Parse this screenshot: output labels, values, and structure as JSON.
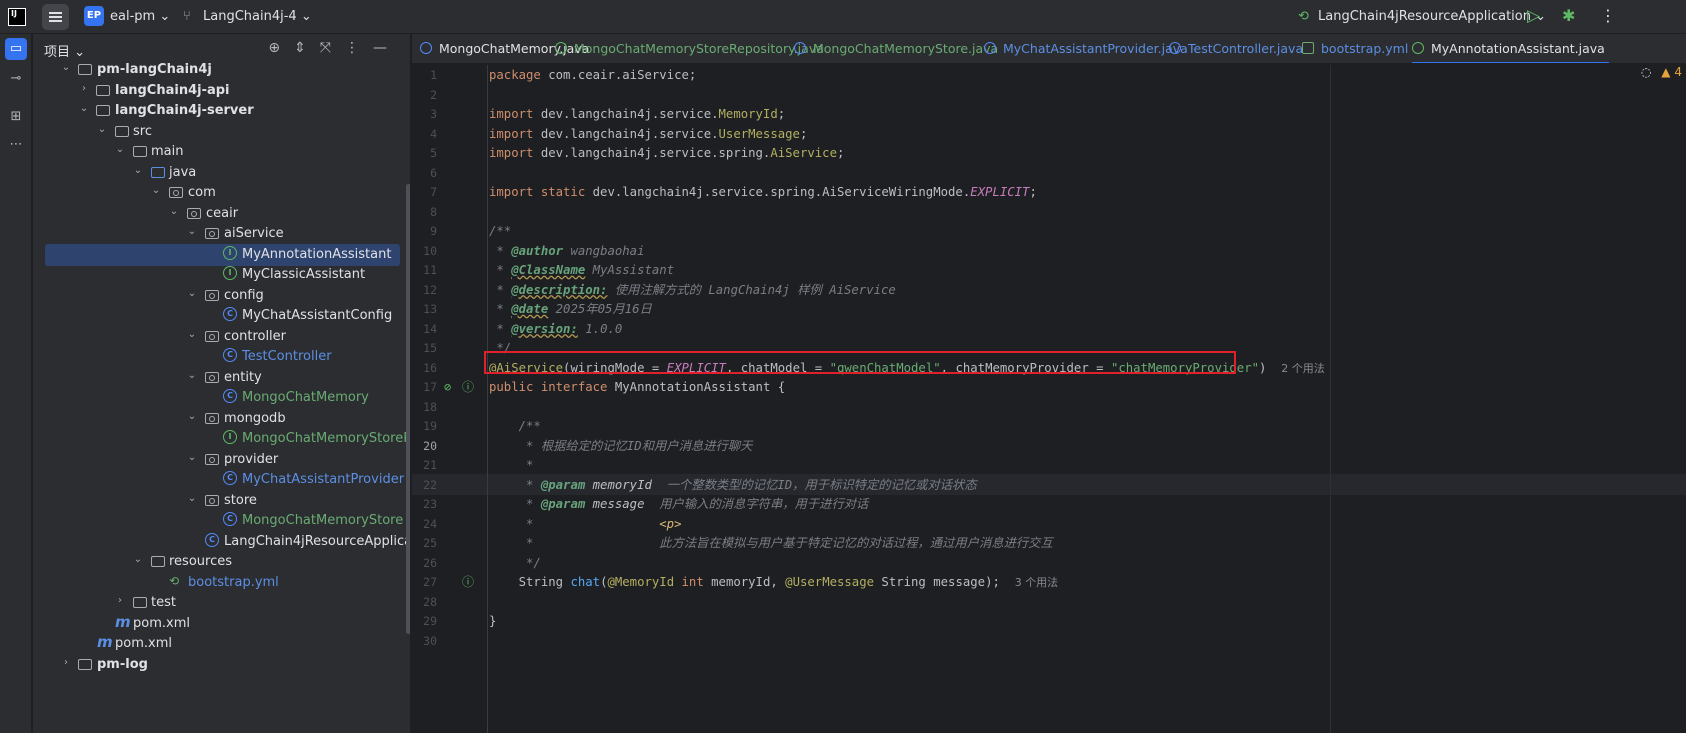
{
  "titlebar": {
    "app_logo": "IJ",
    "project_badge": "EP",
    "project_name": "eal-pm",
    "branch": "LangChain4j-4",
    "run_config": "LangChain4jResourceApplication"
  },
  "project_panel": {
    "title": "项目",
    "tree": [
      {
        "label": "pm-langChain4j",
        "bold": true
      },
      {
        "label": "langChain4j-api",
        "bold": true
      },
      {
        "label": "langChain4j-server",
        "bold": true
      },
      {
        "label": "src"
      },
      {
        "label": "main"
      },
      {
        "label": "java"
      },
      {
        "label": "com"
      },
      {
        "label": "ceair"
      },
      {
        "label": "aiService"
      },
      {
        "label": "MyAnnotationAssistant"
      },
      {
        "label": "MyClassicAssistant"
      },
      {
        "label": "config"
      },
      {
        "label": "MyChatAssistantConfig"
      },
      {
        "label": "controller"
      },
      {
        "label": "TestController"
      },
      {
        "label": "entity"
      },
      {
        "label": "MongoChatMemory"
      },
      {
        "label": "mongodb"
      },
      {
        "label": "MongoChatMemoryStoreR"
      },
      {
        "label": "provider"
      },
      {
        "label": "MyChatAssistantProvider"
      },
      {
        "label": "store"
      },
      {
        "label": "MongoChatMemoryStore"
      },
      {
        "label": "LangChain4jResourceApplicati"
      },
      {
        "label": "resources"
      },
      {
        "label": "bootstrap.yml"
      },
      {
        "label": "test"
      },
      {
        "label": "pom.xml"
      },
      {
        "label": "pom.xml"
      },
      {
        "label": "pm-log",
        "bold": true
      }
    ]
  },
  "tabs": [
    {
      "label": "MongoChatMemory.java"
    },
    {
      "label": "MongoChatMemoryStoreRepository.java"
    },
    {
      "label": "MongoChatMemoryStore.java"
    },
    {
      "label": "MyChatAssistantProvider.java"
    },
    {
      "label": "TestController.java"
    },
    {
      "label": "bootstrap.yml"
    },
    {
      "label": "MyAnnotationAssistant.java"
    }
  ],
  "editor": {
    "status_warnings": "4",
    "line_numbers": [
      "1",
      "2",
      "3",
      "4",
      "5",
      "6",
      "7",
      "8",
      "9",
      "10",
      "11",
      "12",
      "13",
      "14",
      "15",
      "16",
      "17",
      "18",
      "19",
      "20",
      "21",
      "22",
      "23",
      "24",
      "25",
      "26",
      "27",
      "28",
      "29",
      "30"
    ],
    "current_line": "20",
    "code": {
      "l1_kw": "package",
      "l1_rest": " com.ceair.aiService;",
      "l3_kw": "import",
      "l3_a": " dev.langchain4j.service.",
      "l3_b": "MemoryId",
      "l3_c": ";",
      "l4_kw": "import",
      "l4_a": " dev.langchain4j.service.",
      "l4_b": "UserMessage",
      "l4_c": ";",
      "l5_kw": "import",
      "l5_a": " dev.langchain4j.service.spring.",
      "l5_b": "AiService",
      "l5_c": ";",
      "l7_kw": "import static",
      "l7_a": " dev.langchain4j.service.spring.AiServiceWiringMode.",
      "l7_b": "EXPLICIT",
      "l7_c": ";",
      "l9": "/**",
      "l10_a": " * ",
      "l10_tag": "@author",
      "l10_b": " wangbaohai",
      "l11_a": " * ",
      "l11_tag": "@ClassName",
      "l11_b": " MyAssistant",
      "l12_a": " * ",
      "l12_tag": "@description:",
      "l12_b": " 使用注解方式的 LangChain4j 样例 AiService",
      "l13_a": " * ",
      "l13_tag": "@date",
      "l13_b": " 2025年05月16日",
      "l14_a": " * ",
      "l14_tag": "@version:",
      "l14_b": " 1.0.0",
      "l15": " */",
      "l16_ann": "@AiService",
      "l16_a": "(wiringMode = ",
      "l16_const": "EXPLICIT",
      "l16_b": ", chatModel = ",
      "l16_str1": "\"qwenChatModel\"",
      "l16_c": ", chatMemoryProvider = ",
      "l16_str2": "\"chatMemoryProvider\"",
      "l16_d": ")",
      "l16_hint": "2 个用法",
      "l17_kw": "public interface",
      "l17_rest": " MyAnnotationAssistant {",
      "l19": "    /**",
      "l20": "     * 根据给定的记忆ID和用户消息进行聊天",
      "l21": "     *",
      "l22_a": "     * ",
      "l22_tag": "@param",
      "l22_p": " memoryId",
      "l22_b": "  一个整数类型的记忆ID，用于标识特定的记忆或对话状态",
      "l23_a": "     * ",
      "l23_tag": "@param",
      "l23_p": " message",
      "l23_b": "  用户输入的消息字符串，用于进行对话",
      "l24_a": "     *                 ",
      "l24_tag": "<p>",
      "l25": "     *                 此方法旨在模拟与用户基于特定记忆的对话过程，通过用户消息进行交互",
      "l26": "     */",
      "l27_a": "    String ",
      "l27_fn": "chat",
      "l27_b": "(",
      "l27_ann1": "@MemoryId",
      "l27_kw": " int",
      "l27_c": " memoryId, ",
      "l27_ann2": "@UserMessage",
      "l27_d": " String message);",
      "l27_hint": "3 个用法",
      "l29": "}"
    }
  }
}
